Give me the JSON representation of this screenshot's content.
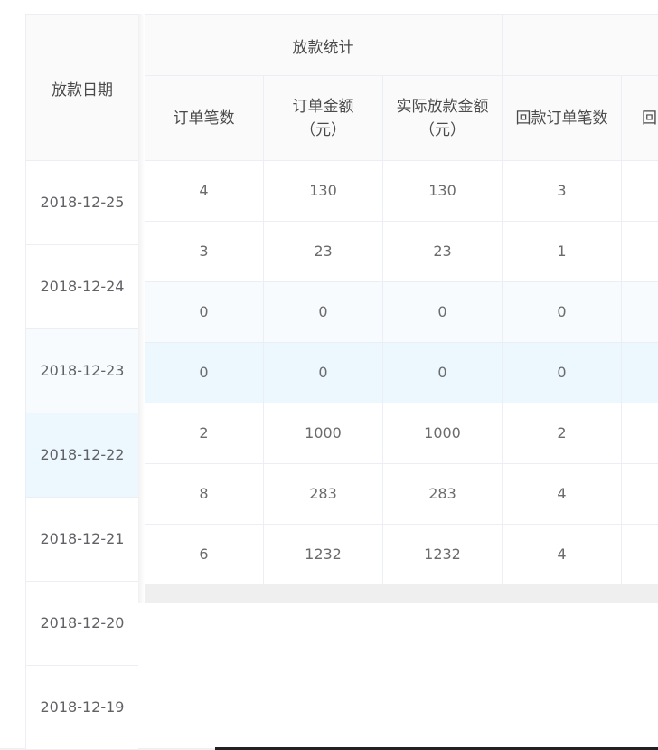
{
  "table": {
    "fixed_header": "放款日期",
    "group_headers": [
      "放款统计",
      ""
    ],
    "columns": [
      "订单笔数",
      "订单金额（元）",
      "实际放款金额（元）",
      "回款订单笔数",
      "回"
    ],
    "dates": [
      "2018-12-25",
      "2018-12-24",
      "2018-12-23",
      "2018-12-22",
      "2018-12-21",
      "2018-12-20",
      "2018-12-19"
    ],
    "rows": [
      {
        "order_count": "4",
        "order_amount": "130",
        "actual_amount": "130",
        "repay_count": "3"
      },
      {
        "order_count": "3",
        "order_amount": "23",
        "actual_amount": "23",
        "repay_count": "1"
      },
      {
        "order_count": "0",
        "order_amount": "0",
        "actual_amount": "0",
        "repay_count": "0"
      },
      {
        "order_count": "0",
        "order_amount": "0",
        "actual_amount": "0",
        "repay_count": "0"
      },
      {
        "order_count": "2",
        "order_amount": "1000",
        "actual_amount": "1000",
        "repay_count": "2"
      },
      {
        "order_count": "8",
        "order_amount": "283",
        "actual_amount": "283",
        "repay_count": "4"
      },
      {
        "order_count": "6",
        "order_amount": "1232",
        "actual_amount": "1232",
        "repay_count": "4"
      }
    ]
  }
}
